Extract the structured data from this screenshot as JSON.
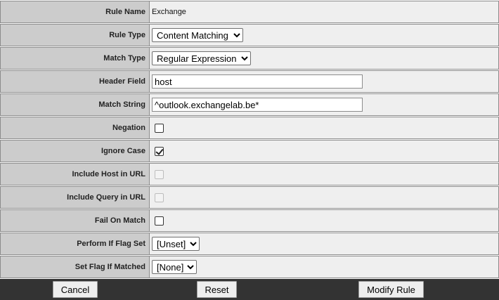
{
  "rows": [
    {
      "label": "Rule Name",
      "value": "Exchange"
    },
    {
      "label": "Rule Type",
      "value": "Content Matching"
    },
    {
      "label": "Match Type",
      "value": "Regular Expression"
    },
    {
      "label": "Header Field",
      "value": "host"
    },
    {
      "label": "Match String",
      "value": "^outlook.exchangelab.be*"
    },
    {
      "label": "Negation",
      "checked": false,
      "enabled": true
    },
    {
      "label": "Ignore Case",
      "checked": true,
      "enabled": true
    },
    {
      "label": "Include Host in URL",
      "checked": false,
      "enabled": false
    },
    {
      "label": "Include Query in URL",
      "checked": false,
      "enabled": false
    },
    {
      "label": "Fail On Match",
      "checked": false,
      "enabled": true
    },
    {
      "label": "Perform If Flag Set",
      "value": "[Unset]"
    },
    {
      "label": "Set Flag If Matched",
      "value": "[None]"
    }
  ],
  "buttons": {
    "cancel": "Cancel",
    "reset": "Reset",
    "modify": "Modify Rule"
  },
  "colors": {
    "label_bg": "#cccccc",
    "value_bg": "#efefef",
    "footer_bg": "#333333"
  }
}
